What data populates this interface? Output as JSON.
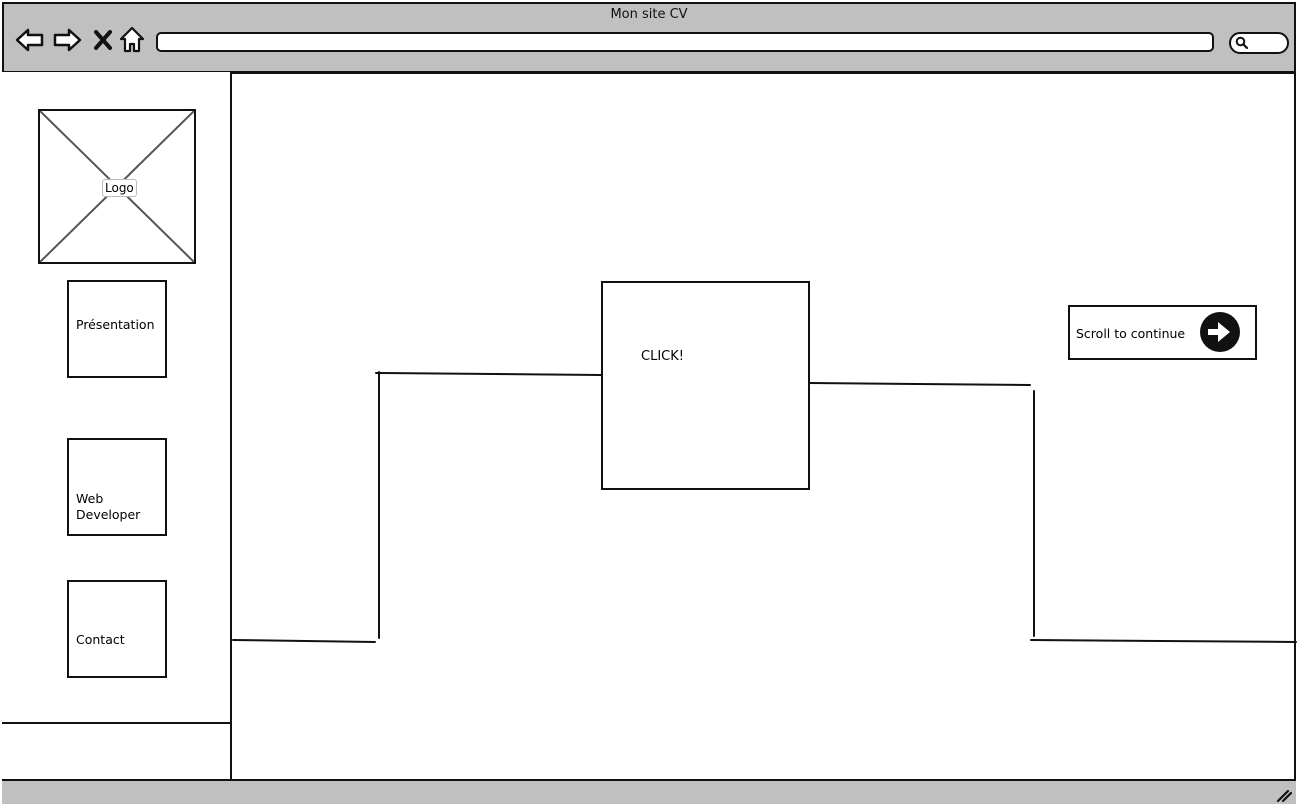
{
  "window": {
    "title": "Mon site CV",
    "address_value": "",
    "search_value": ""
  },
  "toolbar": {
    "icons": [
      "back-arrow-icon",
      "forward-arrow-icon",
      "close-icon",
      "home-icon"
    ]
  },
  "sidebar": {
    "logo_label": "Logo",
    "items": [
      {
        "label": "Présentation"
      },
      {
        "label": "Web\nDeveloper"
      },
      {
        "label": "Contact"
      }
    ]
  },
  "main": {
    "click_label": "CLICK!",
    "scroll_label": "Scroll to continue",
    "scroll_icon": "arrow-right-circle-icon"
  },
  "colors": {
    "chrome": "#c0c0c0",
    "stroke": "#111111"
  }
}
